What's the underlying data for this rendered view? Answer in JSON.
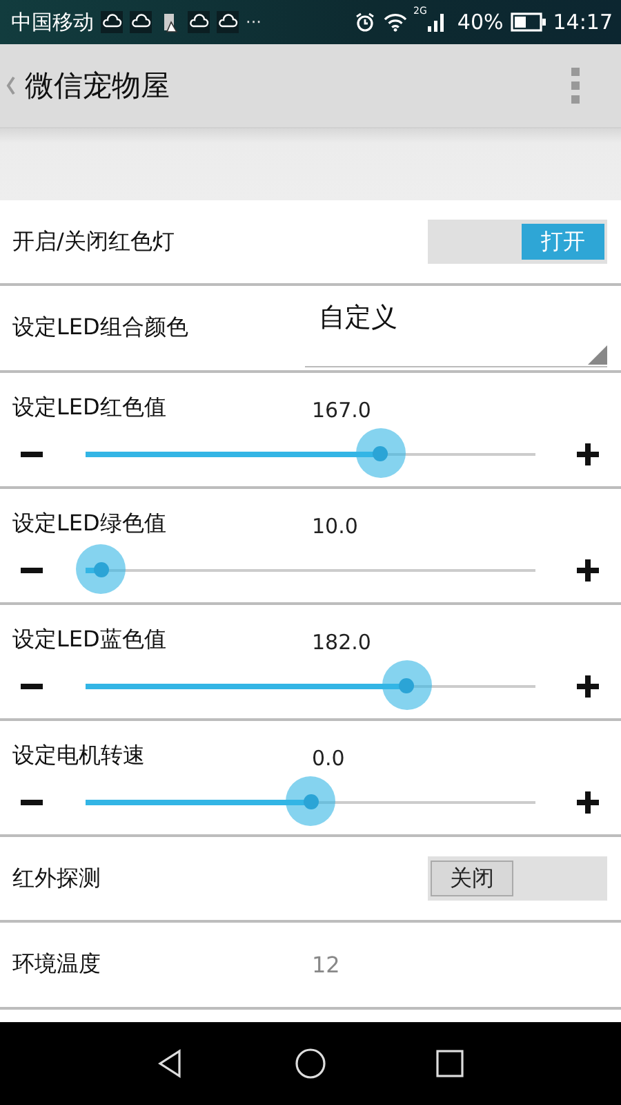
{
  "status_bar": {
    "carrier": "中国移动",
    "overflow": "···",
    "network": "2G",
    "battery": "40%",
    "time": "14:17"
  },
  "action_bar": {
    "title": "微信宠物屋"
  },
  "rows": [
    {
      "kind": "toggle",
      "label": "开启/关闭红色灯",
      "on": true,
      "text": "打开"
    },
    {
      "kind": "select",
      "label": "设定LED组合颜色",
      "value": "自定义"
    },
    {
      "kind": "slider",
      "label": "设定LED红色值",
      "reading": "167.0",
      "level": 0.656
    },
    {
      "kind": "slider",
      "label": "设定LED绿色值",
      "reading": "10.0",
      "level": 0.034
    },
    {
      "kind": "slider",
      "label": "设定LED蓝色值",
      "reading": "182.0",
      "level": 0.714
    },
    {
      "kind": "slider",
      "label": "设定电机转速",
      "reading": "0.0",
      "level": 0.5
    },
    {
      "kind": "toggle",
      "label": "红外探测",
      "on": false,
      "text": "关闭"
    },
    {
      "kind": "reading",
      "label": "环境温度",
      "value": "12"
    }
  ]
}
